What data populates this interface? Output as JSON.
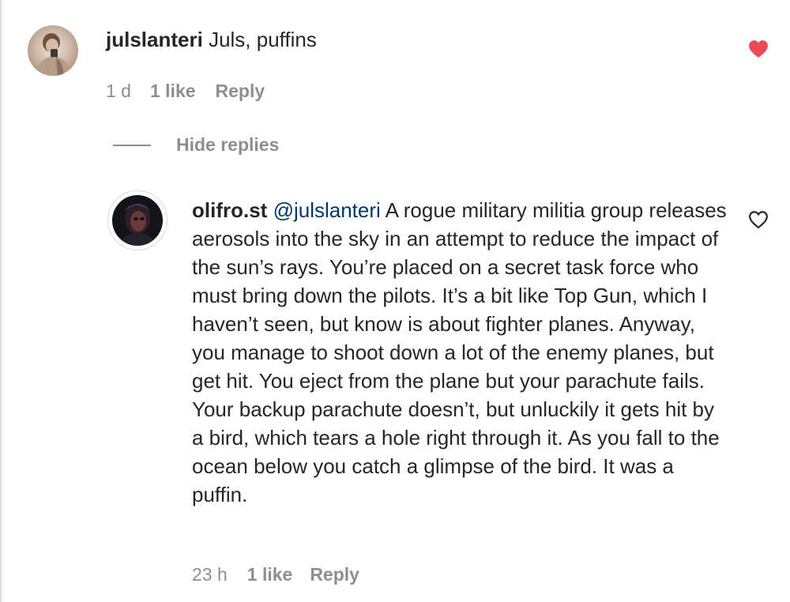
{
  "comments": [
    {
      "username": "julslanteri",
      "text": "Juls, puffins",
      "time": "1 d",
      "likes": "1 like",
      "reply_label": "Reply",
      "liked": true
    }
  ],
  "hide_replies_label": "Hide replies",
  "replies": [
    {
      "username": "olifro.st",
      "mention": "@julslanteri",
      "text": "A rogue military militia group releases aerosols into the sky in an attempt to reduce the impact of the sun’s rays. You’re placed on a secret task force who must bring down the pilots. It’s a bit like Top Gun, which I haven’t seen, but know is about fighter planes. Anyway, you manage to shoot down a lot of the enemy planes, but get hit. You eject from the plane but your parachute fails. Your backup parachute doesn’t, but unluckily it gets hit by a bird, which tears a hole right through it. As you fall to the ocean below you catch a glimpse of the bird. It was a puffin.",
      "time": "23 h",
      "likes": "1 like",
      "reply_label": "Reply",
      "liked": false
    }
  ],
  "colors": {
    "heart_liked": "#ed4956",
    "meta_text": "#8e8e8e",
    "mention": "#00376b"
  },
  "icons": {
    "like_filled": "heart-filled-icon",
    "like_outline": "heart-outline-icon"
  }
}
